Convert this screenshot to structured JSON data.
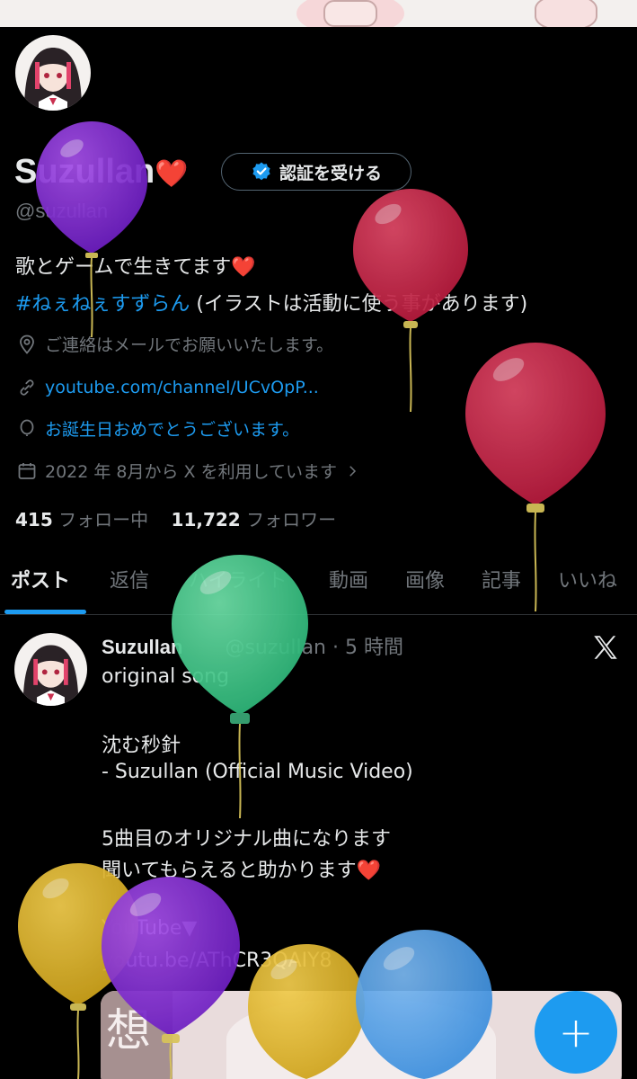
{
  "profile": {
    "name": "Suzullan",
    "name_emoji": "❤️",
    "verify_button": "認証を受ける",
    "handle": "@suzullan",
    "bio_line1": "歌とゲームで生きてます",
    "bio_emoji": "❤️",
    "bio_hashtag": "#ねぇねぇすずらん",
    "bio_line2_rest": " (イラストは活動に使う事があります)",
    "contact": "ご連絡はメールでお願いいたします。",
    "link": "youtube.com/channel/UCvOpP...",
    "birthday": "お誕生日おめでとうございます。",
    "joined": "2022 年 8月から X を利用しています",
    "following_count": "415",
    "following_label": "フォロー中",
    "followers_count": "11,722",
    "followers_label": "フォロワー"
  },
  "tabs": [
    "ポスト",
    "返信",
    "ハイライト",
    "動画",
    "画像",
    "記事",
    "いいね"
  ],
  "post": {
    "author": "Suzullan",
    "handle_time": "@suzullan · 5 時間",
    "lines": [
      "original song",
      "沈む秒針",
      " - Suzullan (Official Music Video)",
      "5曲目のオリジナル曲になります",
      "聞いてもらえると助かります",
      "YouTube▼",
      "youtu.be/AThCR3QAIY8"
    ],
    "heart_emoji": "❤️",
    "media_char": "想"
  },
  "fab_label": "+",
  "colors": {
    "accent": "#1d9bf0",
    "background": "#000000",
    "text": "#e7e9ea",
    "muted": "#71767b"
  }
}
